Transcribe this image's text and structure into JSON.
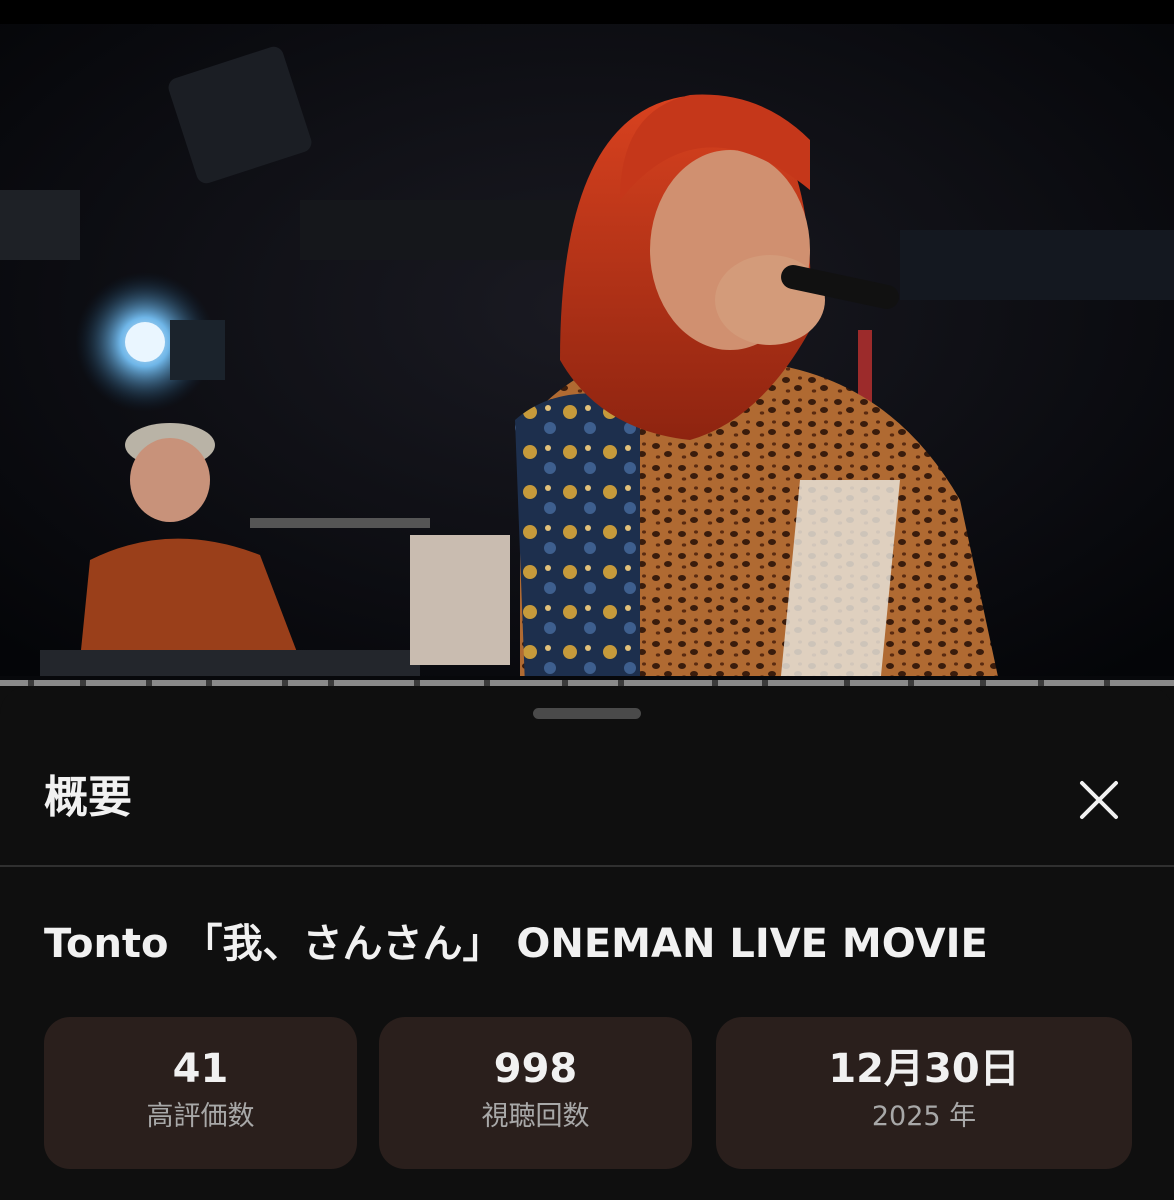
{
  "video": {
    "scene": "live-performance-thumbnail"
  },
  "sheet": {
    "title": "概要",
    "close_icon": "close-icon"
  },
  "video_info": {
    "title": "Tonto 「我、さんさん」 ONEMAN LIVE MOVIE"
  },
  "stats": {
    "likes": {
      "value": "41",
      "label": "高評価数"
    },
    "views": {
      "value": "998",
      "label": "視聴回数"
    },
    "date": {
      "value": "12月30日",
      "label": "2025 年"
    }
  },
  "colors": {
    "background": "#0f0f0f",
    "card": "#2a1f1c",
    "text_primary": "#f1f1f1",
    "text_secondary": "#a8a8a8"
  }
}
